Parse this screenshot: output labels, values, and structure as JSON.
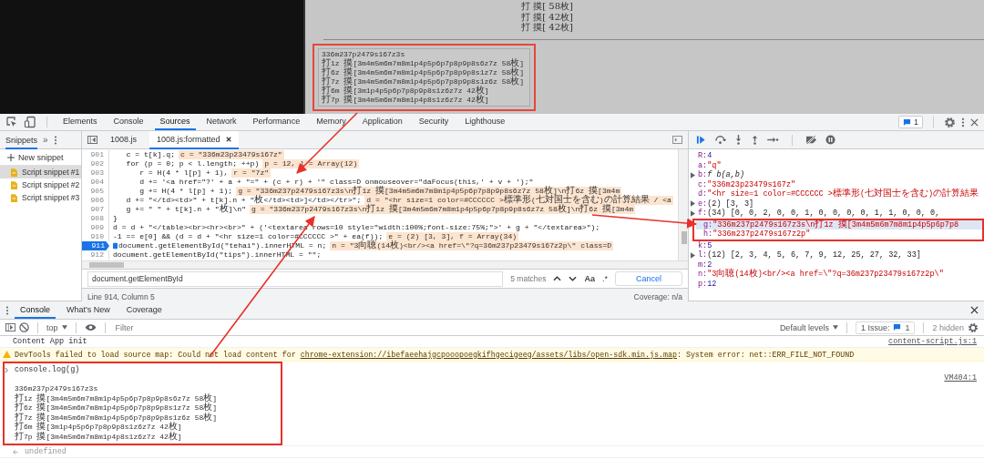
{
  "page": {
    "lines": [
      "打 摸[ 58枚]",
      "打 摸[ 42枚]",
      "打 摸[ 42枚]"
    ],
    "textarea": {
      "lines": [
        "336m237p2479s167z3s",
        "打1z 摸[3m4m5m6m7m8m1p4p5p6p7p8p9p8s6z7z 58枚]",
        "打6z 摸[3m4m5m6m7m8m1p4p5p6p7p8p9p8s1z7z 58枚]",
        "打7z 摸[3m4m5m6m7m8m1p4p5p6p7p8p9p8s1z6z 58枚]",
        "打6m 摸[3m1p4p5p6p7p8p9p8s1z6z7z 42枚]",
        "打7p 摸[3m4m5m6m7m8m1p4p8s1z6z7z 42枚]"
      ]
    }
  },
  "devtools": {
    "tabs": [
      {
        "label": "Elements",
        "selected": false
      },
      {
        "label": "Console",
        "selected": false
      },
      {
        "label": "Sources",
        "selected": true
      },
      {
        "label": "Network",
        "selected": false
      },
      {
        "label": "Performance",
        "selected": false
      },
      {
        "label": "Memory",
        "selected": false
      },
      {
        "label": "Application",
        "selected": false
      },
      {
        "label": "Security",
        "selected": false
      },
      {
        "label": "Lighthouse",
        "selected": false
      }
    ],
    "issues_count": "1"
  },
  "sources": {
    "sidebar": {
      "title": "Snippets",
      "more": "»",
      "new_snippet": "New snippet",
      "items": [
        {
          "label": "Script snippet #1",
          "selected": true
        },
        {
          "label": "Script snippet #2",
          "selected": false
        },
        {
          "label": "Script snippet #3",
          "selected": false
        }
      ]
    },
    "files": [
      {
        "label": "1008.js",
        "selected": false
      },
      {
        "label": "1008.js:formatted",
        "selected": true
      }
    ],
    "code": [
      {
        "number": "901",
        "code": "   c = t[k].q;",
        "value": "c = \"336m23p23479s167z\"",
        "current": false
      },
      {
        "number": "902",
        "code": "   for (p = 0; p < l.length; ++p)",
        "value": "p = 12, l = Array(12)",
        "current": false
      },
      {
        "number": "903",
        "code": "      r = H(4 * l[p] + 1),",
        "value": "r = \"7z\"",
        "current": false
      },
      {
        "number": "904",
        "code": "      d += '<a href=\"?' + a + \"=\" + (c + r) + '\" class=D onmouseover=\"daFocus(this,' + v + ');\"",
        "current": false
      },
      {
        "number": "905",
        "code": "      g += H(4 * l[p] + 1);",
        "value": "g = \"336m237p2479s167z3s\\n打1z 摸[3m4m5m6m7m8m1p4p5p6p7p8p9p8s6z7z 58枚]\\n打6z 摸[3m4m",
        "current": false
      },
      {
        "number": "906",
        "code": "   d += \"</td><td>\" + t[k].n + \"枚</td><td>]</td></tr>\";",
        "value": "d = \"<hr size=1 color=#CCCCCC >標準形(七対国士を含む)の計算結果 / <a",
        "current": false
      },
      {
        "number": "907",
        "code": "   g += \" \" + t[k].n + \"枚]\\n\"",
        "value": "g = \"336m237p2479s167z3s\\n打1z 摸[3m4m5m6m7m8m1p4p5p6p7p8p9p8s6z7z 58枚]\\n打6z 摸[3m4m",
        "current": false
      },
      {
        "number": "908",
        "code": "}",
        "current": false
      },
      {
        "number": "909",
        "code": "d = d + \"</table><br><hr><br>\" + ('<textarea rows=10 style=\"width:100%;font-size:75%;\">' + g + \"</textarea>\");",
        "current": false
      },
      {
        "number": "910",
        "code": "-1 == e[0] && (d = d + \"<hr size=1 color=#CCCCCC >\" + ea(f));",
        "value": "e = (2) [3, 3], f = Array(34)",
        "current": false
      },
      {
        "number": "911",
        "code": "document.getElementById(\"tehai\").innerHTML = n;",
        "value": "n = \"3向聴(14枚)<br/><a href=\\\"?q=36m237p23479s167z2p\\\" class=D",
        "current": true
      },
      {
        "number": "912",
        "code": "document.getElementById(\"tips\").innerHTML = \"\";",
        "current": false
      }
    ],
    "search": {
      "value": "document.getElementById",
      "matches": "5 matches",
      "case_label": "Aa",
      "regex_label": ".*",
      "cancel": "Cancel"
    },
    "status": "Line 914, Column 5",
    "coverage": "Coverage: n/a"
  },
  "scope": {
    "groups": [
      {
        "items": [
          {
            "key": "R:",
            "value": "4",
            "kind": "number",
            "expandable": false,
            "selected": false
          },
          {
            "key": "a:",
            "value": "\"q\"",
            "kind": "string",
            "expandable": false,
            "selected": false
          },
          {
            "key": "b:",
            "value": "f b(a,b)",
            "kind": "function",
            "expandable": true,
            "selected": false
          },
          {
            "key": "c:",
            "value": "\"336m23p23479s167z\"",
            "kind": "string",
            "expandable": false,
            "selected": false
          },
          {
            "key": "d:",
            "value": "\"<hr size=1 color=#CCCCCC >標準形(七対国士を含む)の計算結果",
            "kind": "string",
            "expandable": false,
            "selected": false
          },
          {
            "key": "e:",
            "value": "(2) [3, 3]",
            "kind": "object",
            "expandable": true,
            "selected": false
          },
          {
            "key": "f:",
            "value": "(34) [0, 0, 2, 0, 0, 1, 0, 0, 0, 0, 1, 1, 0, 0, 0,",
            "kind": "object",
            "expandable": true,
            "selected": false
          }
        ]
      },
      {
        "items": [
          {
            "key": "g:",
            "value": "\"336m237p2479s167z3s\\n打1z 摸[3m4m5m6m7m8m1p4p5p6p7p8",
            "kind": "string",
            "expandable": false,
            "selected": true
          },
          {
            "key": "h:",
            "value": "\"336m237p2479s167z2p\"",
            "kind": "string",
            "expandable": false,
            "selected": false
          }
        ]
      },
      {
        "items": [
          {
            "key": "k:",
            "value": "5",
            "kind": "number",
            "expandable": false,
            "selected": false
          },
          {
            "key": "l:",
            "value": "(12) [2, 3, 4, 5, 6, 7, 9, 12, 25, 27, 32, 33]",
            "kind": "object",
            "expandable": true,
            "selected": false
          },
          {
            "key": "m:",
            "value": "2",
            "kind": "number",
            "expandable": false,
            "selected": false
          },
          {
            "key": "n:",
            "value": "\"3向聴(14枚)<br/><a href=\\\"?q=36m237p23479s167z2p\\\"",
            "kind": "string",
            "expandable": false,
            "selected": false
          },
          {
            "key": "p:",
            "value": "12",
            "kind": "number",
            "expandable": false,
            "selected": false
          }
        ]
      }
    ]
  },
  "console": {
    "tabs": [
      {
        "label": "Console",
        "selected": true
      },
      {
        "label": "What's New",
        "selected": false
      },
      {
        "label": "Coverage",
        "selected": false
      }
    ],
    "context": "top",
    "filter_placeholder": "Filter",
    "levels": "Default levels",
    "issues_label": "1 Issue:",
    "issues_count": "1",
    "hidden": "2 hidden",
    "messages": [
      {
        "kind": "log",
        "text": "Content App init",
        "source": "content-script.js:1"
      },
      {
        "kind": "warning",
        "text": "DevTools failed to load source map: Could not load content for ",
        "link": "chrome-extension://ibefaeehajgcpooopoegkifhgecigeeg/assets/libs/open-sdk.min.js.map",
        "after": ": System error: net::ERR_FILE_NOT_FOUND"
      },
      {
        "kind": "command",
        "input": "console.log(g)",
        "source": "VM404:1",
        "lines": [
          "336m237p2479s167z3s",
          "打1z 摸[3m4m5m6m7m8m1p4p5p6p7p8p9p8s6z7z 58枚]",
          "打6z 摸[3m4m5m6m7m8m1p4p5p6p7p8p9p8s1z7z 58枚]",
          "打7z 摸[3m4m5m6m7m8m1p4p5p6p7p8p9p8s1z6z 58枚]",
          "打6m 摸[3m1p4p5p6p7p8p9p8s1z6z7z 42枚]",
          "打7p 摸[3m4m5m6m7m8m1p4p8s1z6z7z 42枚]"
        ]
      },
      {
        "kind": "result",
        "text": "undefined"
      },
      {
        "kind": "prompt"
      }
    ]
  }
}
